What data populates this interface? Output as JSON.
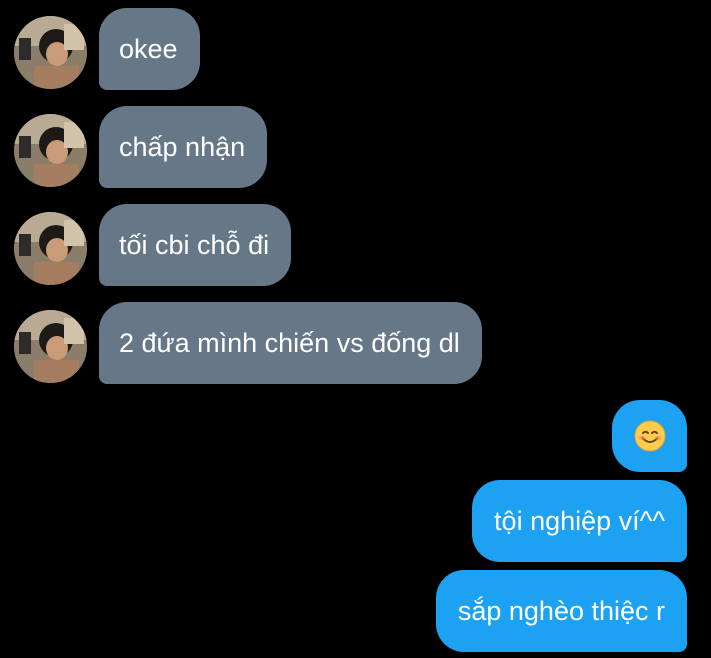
{
  "incoming": [
    {
      "text": "okee"
    },
    {
      "text": "chấp nhận"
    },
    {
      "text": "tối cbi chỗ đi"
    },
    {
      "text": "2 đứa mình chiến vs đống dl"
    }
  ],
  "outgoing": [
    {
      "emoji": "smiling-face-emoji"
    },
    {
      "text": "tội nghiệp ví^^"
    },
    {
      "text": "sắp nghèo thiệc r"
    }
  ],
  "colors": {
    "background": "#000000",
    "incoming_bubble": "#667788",
    "outgoing_bubble": "#1da1f2",
    "text": "#ffffff"
  }
}
